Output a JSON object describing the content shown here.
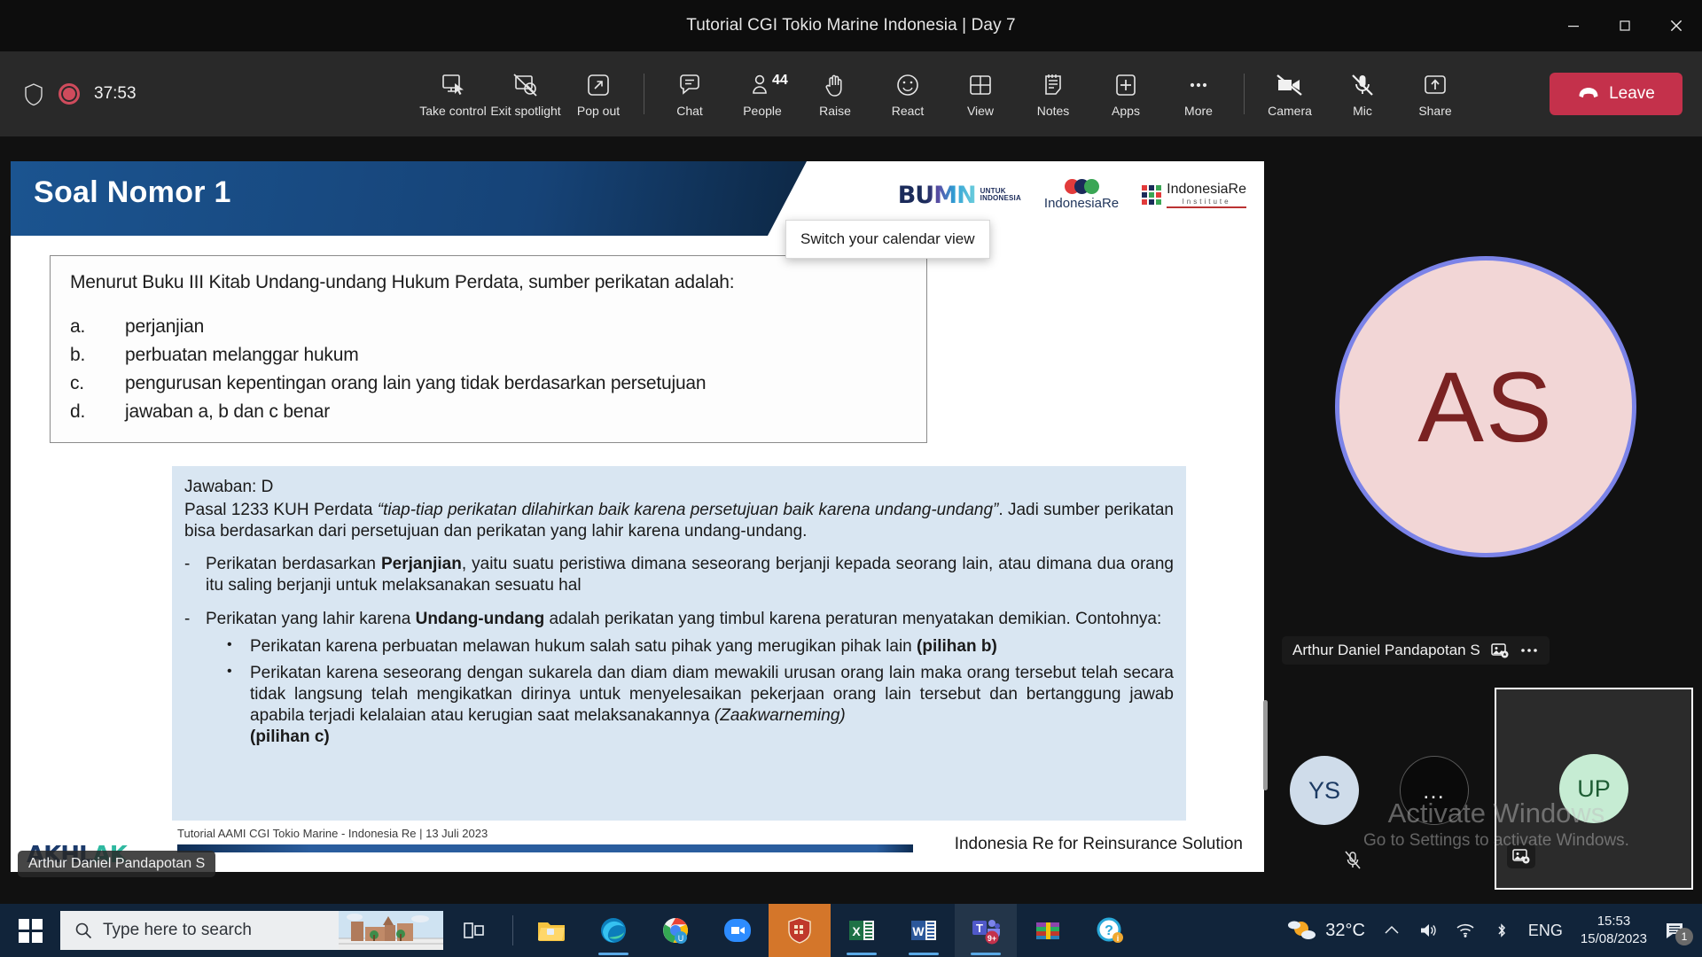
{
  "window": {
    "title": "Tutorial CGI Tokio Marine Indonesia | Day 7",
    "minimize_label": "Minimize",
    "maximize_label": "Maximize",
    "close_label": "Close"
  },
  "toolbar": {
    "recording_time": "37:53",
    "items": [
      {
        "label": "Take control",
        "icon": "take-control-icon"
      },
      {
        "label": "Exit spotlight",
        "icon": "exit-spotlight-icon"
      },
      {
        "label": "Pop out",
        "icon": "pop-out-icon"
      },
      {
        "label": "Chat",
        "icon": "chat-icon"
      },
      {
        "label": "People",
        "icon": "people-icon",
        "badge": "44"
      },
      {
        "label": "Raise",
        "icon": "raise-hand-icon"
      },
      {
        "label": "React",
        "icon": "react-icon"
      },
      {
        "label": "View",
        "icon": "view-icon"
      },
      {
        "label": "Notes",
        "icon": "notes-icon"
      },
      {
        "label": "Apps",
        "icon": "apps-icon"
      },
      {
        "label": "More",
        "icon": "more-icon"
      }
    ],
    "camera_label": "Camera",
    "mic_label": "Mic",
    "share_label": "Share",
    "leave_label": "Leave",
    "leave_color": "#c4314b"
  },
  "tooltip": {
    "text": "Switch your calendar view"
  },
  "slide": {
    "title": "Soal Nomor 1",
    "header_color": "#164377",
    "logos": [
      {
        "name": "bumn-logo",
        "word": "BUMN",
        "sub_line1": "UNTUK",
        "sub_line2": "INDONESIA"
      },
      {
        "name": "indonesia-re-logo",
        "text": "IndonesiaRe"
      },
      {
        "name": "indonesia-re-institute-logo",
        "text": "IndonesiaRe",
        "sub": "Institute"
      }
    ],
    "question": {
      "prompt": "Menurut Buku III Kitab Undang-undang Hukum Perdata, sumber perikatan adalah:",
      "options": [
        {
          "marker": "a.",
          "text": "perjanjian"
        },
        {
          "marker": "b.",
          "text": "perbuatan melanggar hukum"
        },
        {
          "marker": "c.",
          "text": "pengurusan kepentingan orang lain yang tidak berdasarkan persetujuan"
        },
        {
          "marker": "d.",
          "text": "jawaban a, b dan c benar"
        }
      ]
    },
    "answer": {
      "heading": "Jawaban: D",
      "para_pre": "Pasal 1233 KUH Perdata ",
      "para_quote": "“tiap-tiap perikatan dilahirkan baik karena persetujuan baik karena undang-undang”",
      "para_post": ". Jadi sumber perikatan bisa berdasarkan dari persetujuan dan perikatan yang lahir karena undang-undang.",
      "dash_marker": "-",
      "bullet_marker": "•",
      "point1_pre": "Perikatan berdasarkan ",
      "point1_bold": "Perjanjian",
      "point1_post": ", yaitu suatu peristiwa dimana seseorang berjanji kepada seorang lain, atau dimana dua orang itu saling berjanji untuk melaksanakan sesuatu hal",
      "point2_pre": "Perikatan yang lahir karena ",
      "point2_bold": "Undang-undang",
      "point2_post": " adalah perikatan yang timbul karena peraturan menyatakan demikian. Contohnya:",
      "sub1_text": "Perikatan karena perbuatan melawan hukum salah satu pihak yang merugikan pihak lain ",
      "sub1_bold": "(pilihan b)",
      "sub2_text": "Perikatan karena seseorang dengan sukarela dan diam diam mewakili urusan orang lain maka orang tersebut telah secara tidak langsung telah mengikatkan dirinya untuk menyelesaikan pekerjaan orang lain tersebut dan bertanggung jawab apabila terjadi kelalaian atau kerugian saat melaksanakannya ",
      "sub2_italic": "(Zaakwarneming)",
      "sub2_bold": "(pilihan c)"
    },
    "footer": {
      "akhlak_part1": "AKHL",
      "akhlak_part2": "AK",
      "note": "Tutorial AAMI CGI Tokio Marine - Indonesia Re | 13 Juli 2023",
      "right": "Indonesia Re for Reinsurance Solution"
    },
    "presenter_chip": "Arthur Daniel Pandapotan S"
  },
  "participants": {
    "main": {
      "initials": "AS",
      "name": "Arthur Daniel Pandapotan S",
      "pin_icon": "pin-video-icon",
      "more_icon": "more-options-icon",
      "ring_color": "#7b83e8",
      "avatar_color": "#f2d6d6"
    },
    "small": [
      {
        "initials": "YS",
        "muted": true,
        "avatar_color": "#cfdcea"
      },
      {
        "initials": "…",
        "muted": false,
        "avatar_color": "#0a0a0a"
      },
      {
        "initials": "UP",
        "muted": false,
        "avatar_color": "#c6ecd3",
        "highlighted": true,
        "pin_icon": "pin-video-icon"
      }
    ]
  },
  "watermark": {
    "line1": "Activate Windows",
    "line2": "Go to Settings to activate Windows."
  },
  "taskbar": {
    "start_label": "Start",
    "search_placeholder": "Type here to search",
    "task_view_label": "Task view",
    "apps": [
      {
        "name": "file-explorer-icon",
        "label": "File Explorer"
      },
      {
        "name": "microsoft-edge-icon",
        "label": "Microsoft Edge"
      },
      {
        "name": "google-chrome-icon",
        "label": "Google Chrome"
      },
      {
        "name": "zoom-icon",
        "label": "Zoom"
      },
      {
        "name": "security-app-icon",
        "label": "Security"
      },
      {
        "name": "excel-icon",
        "label": "Excel"
      },
      {
        "name": "word-icon",
        "label": "Word"
      },
      {
        "name": "microsoft-teams-icon",
        "label": "Microsoft Teams",
        "badge": "9+"
      },
      {
        "name": "winrar-icon",
        "label": "WinRAR"
      },
      {
        "name": "help-icon",
        "label": "Get Help"
      }
    ],
    "weather_temp": "32°C",
    "language": "ENG",
    "time": "15:53",
    "date": "15/08/2023",
    "notification_count": "1"
  }
}
